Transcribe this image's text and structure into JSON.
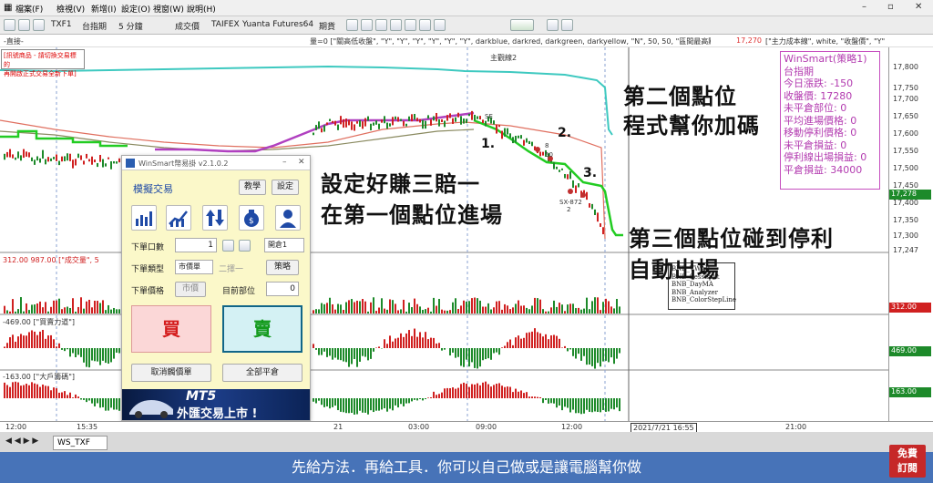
{
  "menu": {
    "items": [
      "檔案(F)",
      "檢視(V)",
      "新增(I)",
      "設定(O)",
      "視窗(W)",
      "說明(H)"
    ],
    "window_controls": [
      "–",
      "▫",
      "✕"
    ]
  },
  "toolbar": {
    "symbol": "TXF1",
    "symbol_name": "台指期",
    "interval": "5 分鐘",
    "chart_type": "成交價",
    "exchange_info": "TAIFEX",
    "broker": "Yuanta Futures64",
    "account_type": "期貨"
  },
  "infobar": {
    "left_text": "-直接-",
    "script_text": "量=0 [\"關高低收盤\", \"Y\", \"Y\", \"Y\", \"Y\", \"Y\", \"Y\", darkblue, darkred, darkgreen, darkyellow, \"N\", 50, 50, \"區間最高點\", \"區間最低點\", \"Tic\"",
    "price_text": "17,270",
    "extra_text": "[\"主力成本線\", white, \"收盤價\", \"Y\""
  },
  "top_note": {
    "line1": "[訊號商品 - 請切換交易標的",
    "line2": "再開啟正式交易全新下單]"
  },
  "chart_label_main": "主觀線2",
  "infobox": {
    "lines": [
      "WinSmart(策略1)",
      "台指期",
      "今日漲跌: -150",
      "收盤價: 17280",
      "未平倉部位: 0",
      "平均進場價格: 0",
      "移動停利價格: 0",
      "未平倉損益: 0",
      "停利線出場損益: 0",
      "平倉損益: 34000"
    ]
  },
  "legend": {
    "lines": [
      "BNB_VWAP",
      "BNB_SessSplit",
      "BNB_DayMA",
      "BNB_Analyzer",
      "BNB_ColorStepLine"
    ]
  },
  "chart_data": {
    "type": "line",
    "title": "台指期",
    "ylim": [
      17247,
      17800
    ],
    "y_ticks": [
      "17,800",
      "17,750",
      "17,700",
      "17,650",
      "17,600",
      "17,550",
      "17,500",
      "17,450",
      "17,400",
      "17,350",
      "17,300",
      "17,247"
    ],
    "price_tag": "17,278",
    "x_tick_labels": [
      "12:00",
      "15:35",
      "21",
      "03:00",
      "09:00",
      "12:00",
      "2021/7/21 16:55",
      "21:00"
    ],
    "series": [
      {
        "name": "主觀線2",
        "color": "#3ec9c0"
      },
      {
        "name": "BNB_VWAP",
        "color": "#e07060"
      }
    ],
    "signal_labels": [
      "SE",
      "SX-872",
      "2",
      "50",
      "8"
    ]
  },
  "panes": {
    "volume_label": "312.00  987.00  [\"成交量\", 5",
    "volume_value": "312.00",
    "force_label": "-469.00  [\"買賣力道\"]",
    "force_value": "469.00",
    "big_label": "-163.00  [\"大戶籌碼\"]",
    "big_value": "163.00"
  },
  "annotations": {
    "point2_title": "第二個點位",
    "point2_desc": "程式幫你加碼",
    "point1_title": "設定好賺三賠一",
    "point1_desc": "在第一個點位進場",
    "point3_title": "第三個點位碰到停利",
    "point3_desc": "自動出場",
    "mark1": "1.",
    "mark2": "2.",
    "mark3": "3."
  },
  "panel": {
    "title": "WinSmart幣易掛 v2.1.0.2",
    "window_controls": [
      "–",
      "✕"
    ],
    "heading": "模擬交易",
    "teach_btn": "教學",
    "settings_btn": "設定",
    "qty_label": "下單口數",
    "qty_value": "1",
    "qty_mode": "開倉1",
    "order_type_label": "下單類型",
    "order_type_value": "市價單",
    "order_type_extra": "二擇一",
    "strategy_btn": "策略",
    "price_label": "下單價格",
    "price_value": "市價",
    "position_label": "目前部位",
    "position_value": "0",
    "buy_label": "買",
    "sell_label": "賣",
    "cancel_btn": "取消觸價單",
    "close_all_btn": "全部平倉",
    "banner_line1": "MT5",
    "banner_line2": "外匯交易上市 !"
  },
  "tabbar": {
    "tab": "WS_TXF"
  },
  "caption": "先給方法．再給工具．你可以自己做或是讓電腦幫你做",
  "subscribe": {
    "line1": "免費",
    "line2": "訂閱"
  },
  "colors": {
    "buy_red": "#d41c1c",
    "sell_green": "#139a1c",
    "caption_bg": "#4773b8",
    "infobox_pink": "#b33cb0"
  }
}
